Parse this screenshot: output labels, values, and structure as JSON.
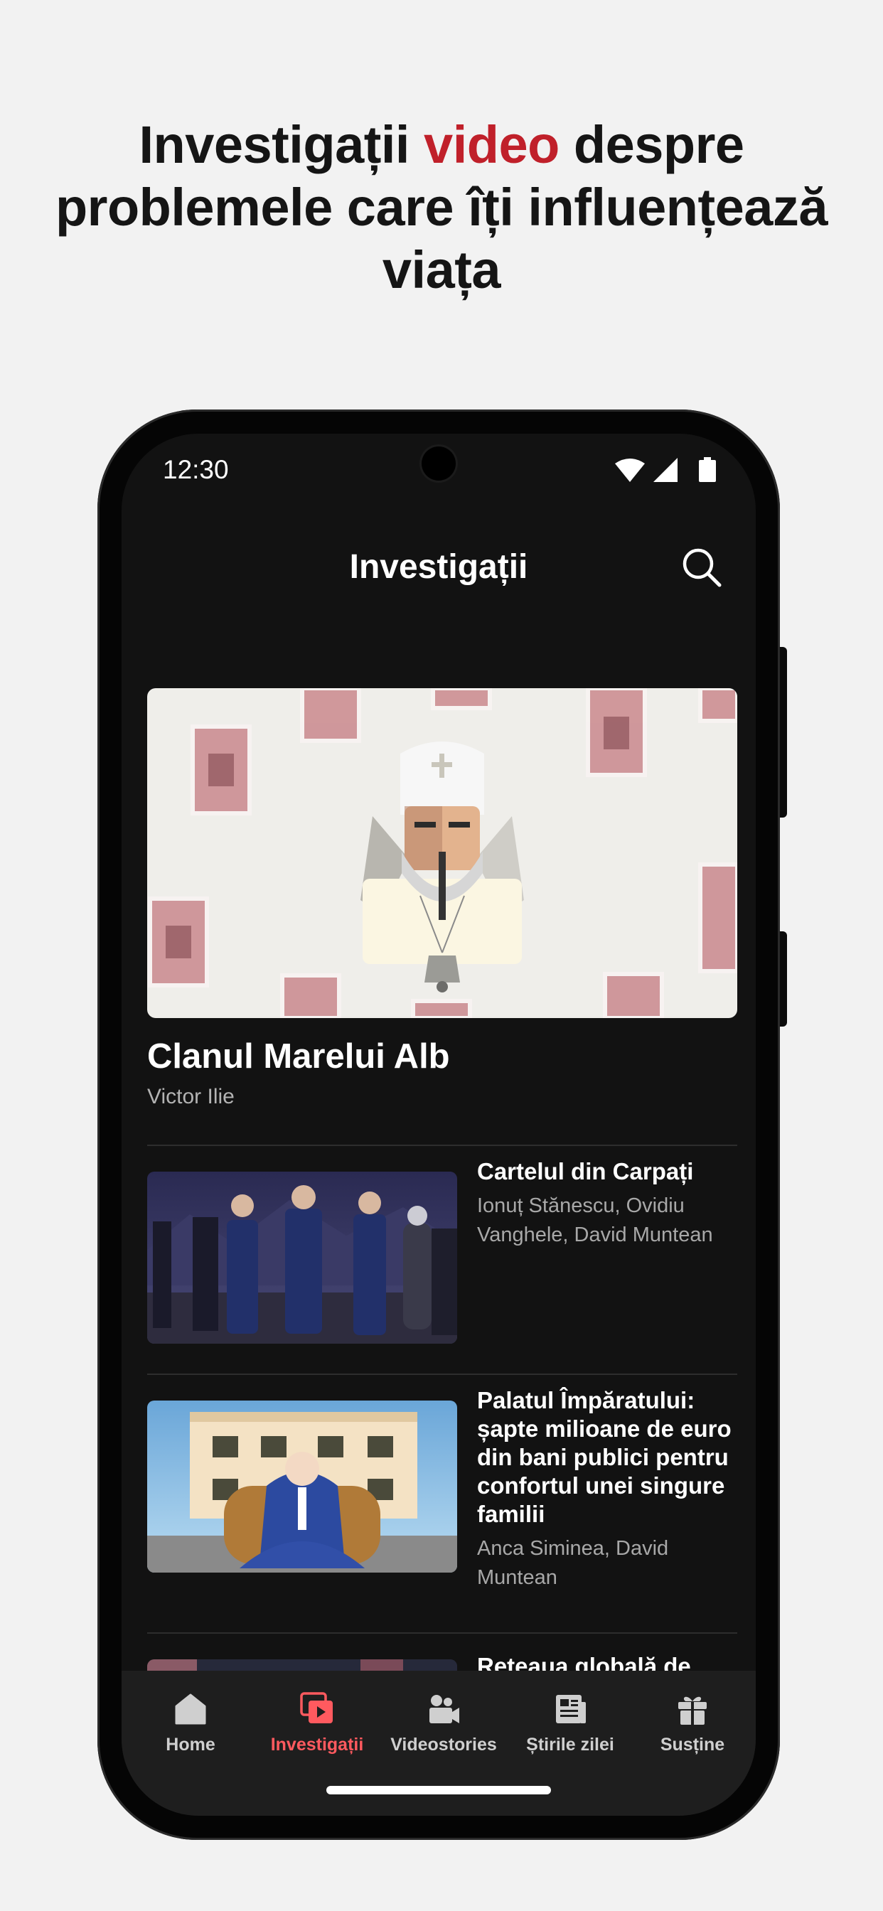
{
  "headline": {
    "part1": "Investigații ",
    "accent": "video",
    "part2": " despre problemele care îți influențează viața"
  },
  "colors": {
    "accent": "#c0202a",
    "nav_active": "#ff5a5f",
    "background": "#f2f2f2",
    "app_background": "#121212"
  },
  "status_bar": {
    "time": "12:30",
    "icons": [
      "wifi-icon",
      "signal-icon",
      "battery-icon"
    ]
  },
  "app_bar": {
    "title": "Investigații",
    "search_icon": "search-icon"
  },
  "featured": {
    "title": "Clanul Marelui Alb",
    "author": "Victor Ilie"
  },
  "articles": [
    {
      "title": "Cartelul din Carpați",
      "authors": "Ionuț Stănescu, Ovidiu Vanghele, David Muntean"
    },
    {
      "title": "Palatul Împăratului: șapte milioane de euro din bani publici pentru confortul unei singure familii",
      "authors": "Anca Siminea, David Muntean"
    },
    {
      "title": "Rețeaua globală de"
    }
  ],
  "bottom_nav": [
    {
      "label": "Home",
      "icon": "home-icon",
      "active": false
    },
    {
      "label": "Investigații",
      "icon": "play-stack-icon",
      "active": true
    },
    {
      "label": "Videostories",
      "icon": "video-camera-icon",
      "active": false
    },
    {
      "label": "Știrile zilei",
      "icon": "newspaper-icon",
      "active": false
    },
    {
      "label": "Susține",
      "icon": "gift-icon",
      "active": false
    }
  ]
}
